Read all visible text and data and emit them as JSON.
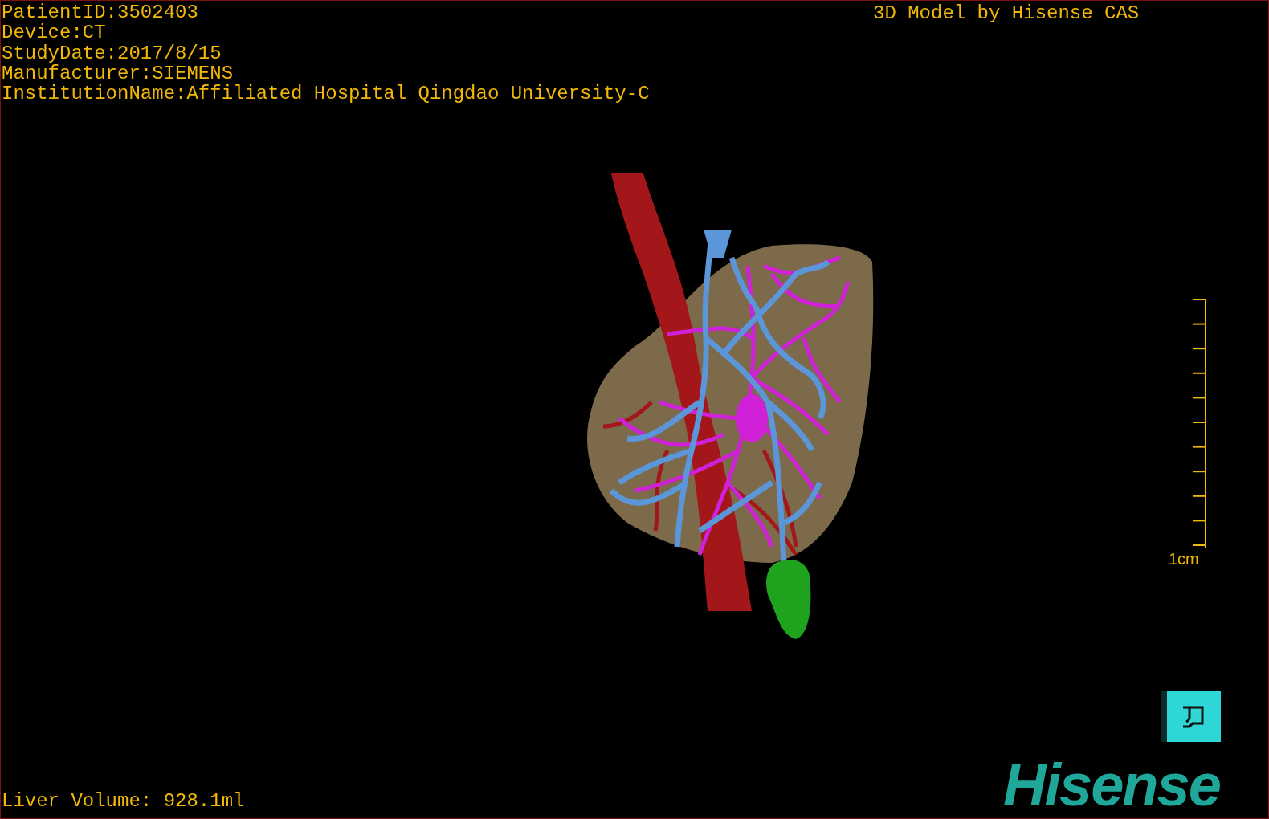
{
  "info_lines": [
    "PatientID:3502403",
    "Device:CT",
    "StudyDate:2017/8/15",
    "Manufacturer:SIEMENS",
    "InstitutionName:Affiliated Hospital Qingdao University-C"
  ],
  "title": "3D Model by Hisense CAS",
  "scale_bar": {
    "label": "1cm"
  },
  "liver_volume": "Liver Volume: 928.1ml",
  "logo": "Hisense"
}
